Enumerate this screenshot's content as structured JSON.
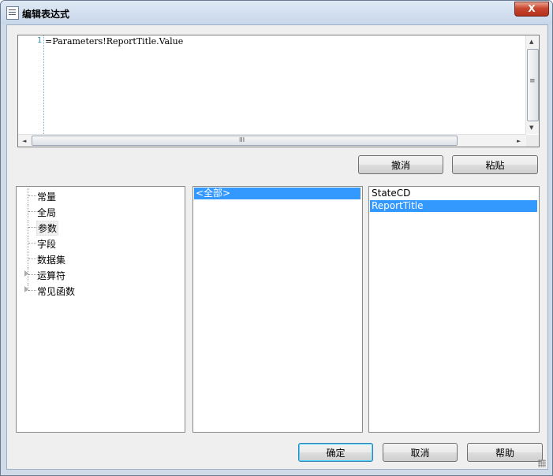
{
  "window": {
    "title": "编辑表达式",
    "close_glyph": "X"
  },
  "editor": {
    "line_number": "1",
    "code": "=Parameters!ReportTitle.Value",
    "hscroll_grip": "III",
    "vscroll_grip": "≡"
  },
  "edit_buttons": {
    "undo": "撤消",
    "paste": "粘贴"
  },
  "category_tree": {
    "items": [
      {
        "label": "常量",
        "expandable": false,
        "selected": false
      },
      {
        "label": "全局",
        "expandable": false,
        "selected": false
      },
      {
        "label": "参数",
        "expandable": false,
        "selected": true
      },
      {
        "label": "字段",
        "expandable": false,
        "selected": false
      },
      {
        "label": "数据集",
        "expandable": false,
        "selected": false
      },
      {
        "label": "运算符",
        "expandable": true,
        "selected": false
      },
      {
        "label": "常见函数",
        "expandable": true,
        "selected": false
      }
    ]
  },
  "subcategory_list": {
    "items": [
      {
        "label": "<全部>",
        "selected": true
      }
    ]
  },
  "item_list": {
    "items": [
      {
        "label": "StateCD",
        "selected": false
      },
      {
        "label": "ReportTitle",
        "selected": true
      }
    ]
  },
  "dialog_buttons": {
    "ok": "确定",
    "cancel": "取消",
    "help": "帮助"
  },
  "colors": {
    "selection": "#3399ff",
    "line_number": "#2b91af"
  }
}
